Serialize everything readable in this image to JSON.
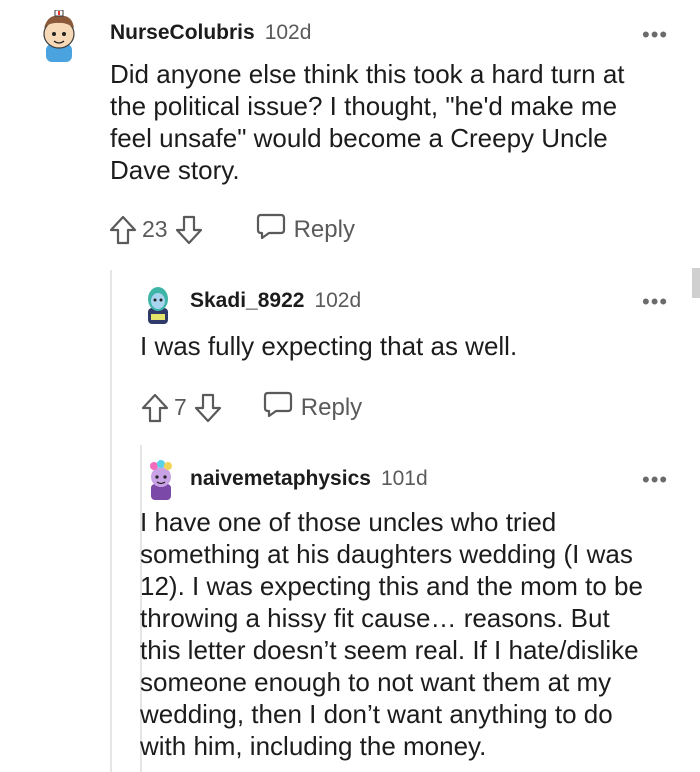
{
  "comments": [
    {
      "username": "NurseColubris",
      "age": "102d",
      "body_lines": [
        "Did anyone else think this took a hard turn at",
        "the political issue? I thought, \"he'd make me",
        "feel unsafe\" would become a Creepy Uncle",
        "Dave story."
      ],
      "votes": "23",
      "reply_label": "Reply",
      "more_label": "•••"
    },
    {
      "username": "Skadi_8922",
      "age": "102d",
      "body_lines": [
        "I was fully expecting that as well."
      ],
      "votes": "7",
      "reply_label": "Reply",
      "more_label": "•••"
    },
    {
      "username": "naivemetaphysics",
      "age": "101d",
      "body_lines": [
        "I have one of those uncles who tried",
        "something at his daughters wedding (I was",
        "12). I was expecting this and the mom to be",
        "throwing a hissy fit cause… reasons. But",
        "this letter doesn’t seem real. If I hate/dislike",
        "someone enough to not want them at my",
        "wedding, then I don’t want anything to do",
        "with him, including the money."
      ],
      "more_label": "•••"
    }
  ],
  "icons": {
    "upvote": "upvote-arrow-icon",
    "downvote": "downvote-arrow-icon",
    "reply": "speech-bubble-icon",
    "more": "more-dots-icon"
  },
  "colors": {
    "text": "#1c1c1c",
    "meta": "#5a5a5a",
    "thread_line": "#e5e5e5"
  }
}
